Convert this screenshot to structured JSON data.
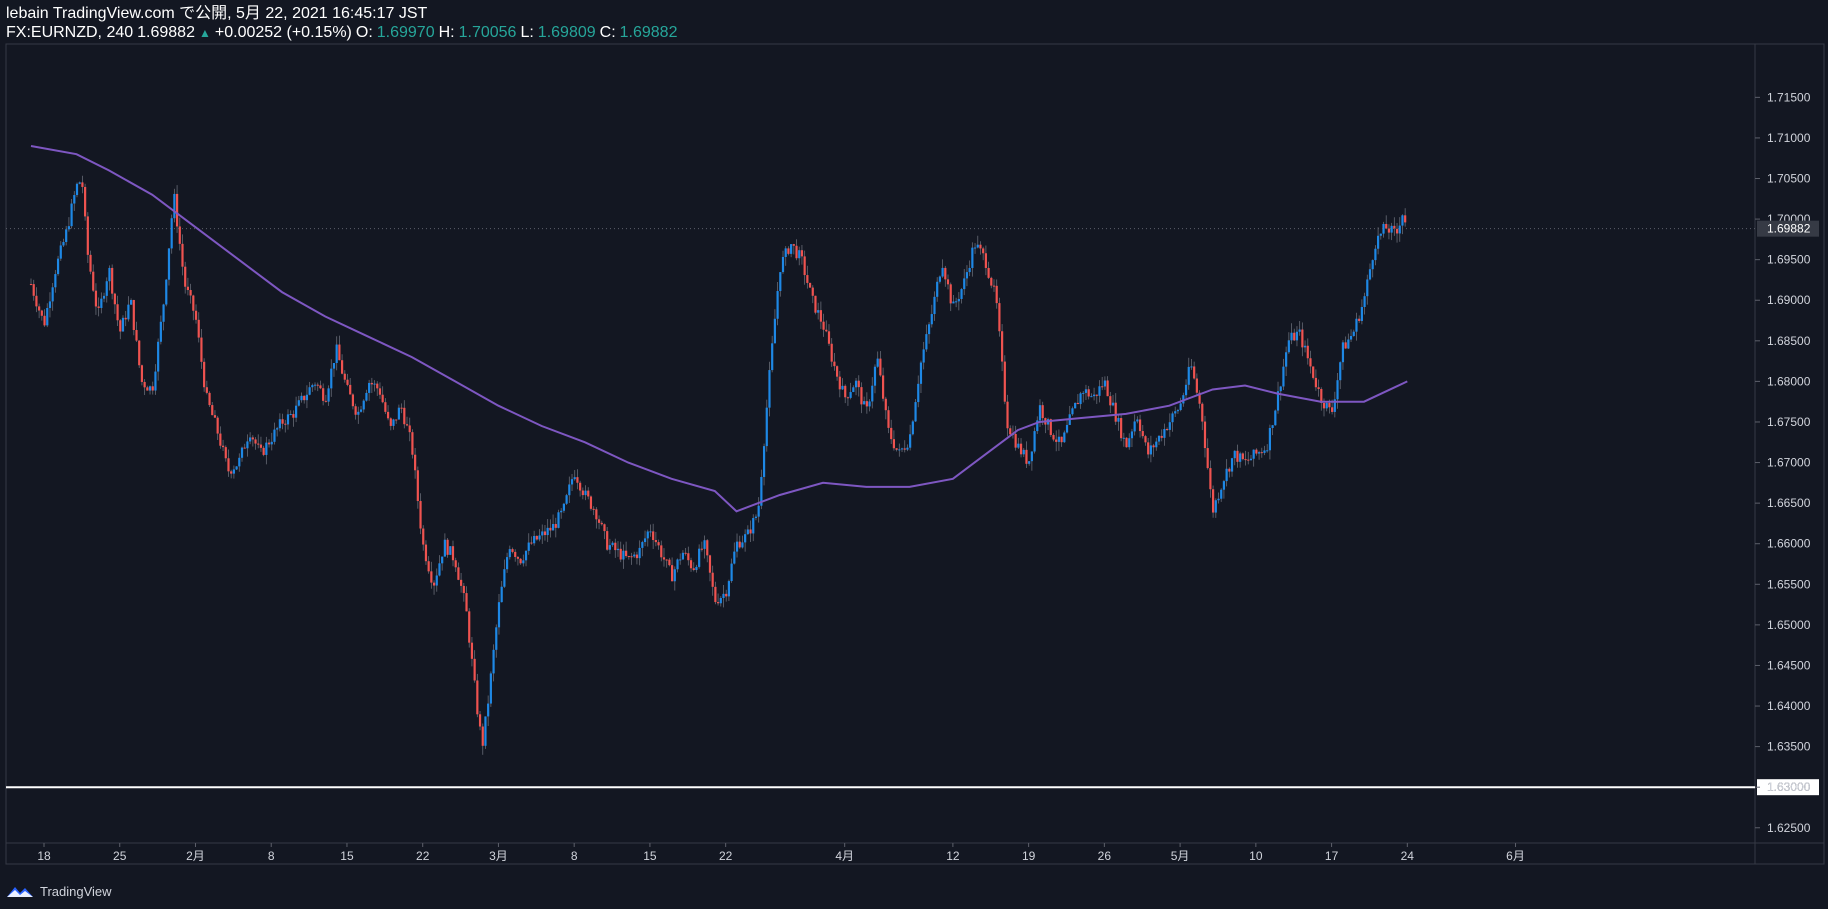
{
  "header": {
    "line1": "lebain TradingView.com で公開, 5月 22, 2021 16:45:17 JST",
    "symbol": "FX:EURNZD, 240",
    "last": "1.69882",
    "change": "+0.00252 (+0.15%)",
    "o_label": "O:",
    "o_val": "1.69970",
    "h_label": "H:",
    "h_val": "1.70056",
    "l_label": "L:",
    "l_val": "1.69809",
    "c_label": "C:",
    "c_val": "1.69882"
  },
  "footer": {
    "brand": "TradingView",
    "logo_icon": "tradingview-logo-icon"
  },
  "colors": {
    "background": "#131722",
    "up": "#2962ff",
    "up_candle": "#1e88e5",
    "down_candle": "#ef5350",
    "ma": "#7e57c2",
    "hline": "#ffffff",
    "axis_text": "#d1d4dc"
  },
  "chart_data": {
    "type": "candlestick",
    "title": "",
    "ylim": [
      1.623,
      1.718
    ],
    "grid": false,
    "y_ticks": [
      "1.71500",
      "1.71000",
      "1.70500",
      "1.70000",
      "1.69500",
      "1.69000",
      "1.68500",
      "1.68000",
      "1.67500",
      "1.67000",
      "1.66500",
      "1.66000",
      "1.65500",
      "1.65000",
      "1.64500",
      "1.64000",
      "1.63500",
      "1.63000",
      "1.62500"
    ],
    "y_tick_values": [
      1.715,
      1.71,
      1.705,
      1.7,
      1.695,
      1.69,
      1.685,
      1.68,
      1.675,
      1.67,
      1.665,
      1.66,
      1.655,
      1.65,
      1.645,
      1.64,
      1.635,
      1.63,
      1.625
    ],
    "x_ticks": [
      "18",
      "25",
      "2月",
      "8",
      "15",
      "22",
      "3月",
      "8",
      "15",
      "22",
      "4月",
      "12",
      "19",
      "26",
      "5月",
      "10",
      "17",
      "24",
      "6月"
    ],
    "x_tick_days": [
      0,
      7,
      14,
      21,
      28,
      35,
      42,
      49,
      56,
      63,
      74,
      84,
      91,
      98,
      105,
      112,
      119,
      126,
      136
    ],
    "last_price_label": "1.69882",
    "last_price": 1.69882,
    "horizontal_line": {
      "value": 1.63,
      "label": "1.63000"
    },
    "price_path": [
      [
        -1.2,
        1.692
      ],
      [
        0,
        1.687
      ],
      [
        1,
        1.6935
      ],
      [
        2,
        1.698
      ],
      [
        3,
        1.704
      ],
      [
        3.5,
        1.705
      ],
      [
        4,
        1.696
      ],
      [
        5,
        1.688
      ],
      [
        6,
        1.694
      ],
      [
        7,
        1.686
      ],
      [
        8,
        1.69
      ],
      [
        9,
        1.68
      ],
      [
        10,
        1.679
      ],
      [
        11,
        1.689
      ],
      [
        12,
        1.703
      ],
      [
        13,
        1.692
      ],
      [
        14,
        1.688
      ],
      [
        15,
        1.678
      ],
      [
        16,
        1.674
      ],
      [
        17,
        1.669
      ],
      [
        18,
        1.67
      ],
      [
        19,
        1.674
      ],
      [
        20,
        1.671
      ],
      [
        21,
        1.673
      ],
      [
        22,
        1.675
      ],
      [
        23,
        1.676
      ],
      [
        24,
        1.678
      ],
      [
        25,
        1.68
      ],
      [
        26,
        1.678
      ],
      [
        27,
        1.684
      ],
      [
        28,
        1.679
      ],
      [
        29,
        1.676
      ],
      [
        30,
        1.68
      ],
      [
        31,
        1.679
      ],
      [
        32,
        1.674
      ],
      [
        33,
        1.677
      ],
      [
        34,
        1.672
      ],
      [
        35,
        1.66
      ],
      [
        36,
        1.655
      ],
      [
        37,
        1.66
      ],
      [
        38,
        1.658
      ],
      [
        39,
        1.652
      ],
      [
        40,
        1.64
      ],
      [
        40.5,
        1.635
      ],
      [
        41,
        1.64
      ],
      [
        42,
        1.652
      ],
      [
        43,
        1.66
      ],
      [
        44,
        1.658
      ],
      [
        45,
        1.66
      ],
      [
        46,
        1.661
      ],
      [
        47,
        1.662
      ],
      [
        48,
        1.664
      ],
      [
        49,
        1.669
      ],
      [
        50,
        1.666
      ],
      [
        51,
        1.664
      ],
      [
        52,
        1.66
      ],
      [
        53,
        1.659
      ],
      [
        54,
        1.658
      ],
      [
        55,
        1.659
      ],
      [
        56,
        1.662
      ],
      [
        57,
        1.659
      ],
      [
        58,
        1.656
      ],
      [
        59,
        1.659
      ],
      [
        60,
        1.657
      ],
      [
        61,
        1.66
      ],
      [
        62,
        1.653
      ],
      [
        63,
        1.654
      ],
      [
        64,
        1.66
      ],
      [
        65,
        1.661
      ],
      [
        66,
        1.664
      ],
      [
        67,
        1.68
      ],
      [
        68,
        1.694
      ],
      [
        69,
        1.697
      ],
      [
        70,
        1.695
      ],
      [
        71,
        1.69
      ],
      [
        72,
        1.687
      ],
      [
        73,
        1.682
      ],
      [
        74,
        1.678
      ],
      [
        75,
        1.68
      ],
      [
        76,
        1.676
      ],
      [
        77,
        1.683
      ],
      [
        78,
        1.674
      ],
      [
        79,
        1.671
      ],
      [
        80,
        1.673
      ],
      [
        81,
        1.682
      ],
      [
        82,
        1.688
      ],
      [
        83,
        1.695
      ],
      [
        84,
        1.689
      ],
      [
        85,
        1.692
      ],
      [
        86,
        1.697
      ],
      [
        87,
        1.695
      ],
      [
        88,
        1.69
      ],
      [
        89,
        1.675
      ],
      [
        90,
        1.672
      ],
      [
        91,
        1.67
      ],
      [
        92,
        1.677
      ],
      [
        93,
        1.674
      ],
      [
        94,
        1.672
      ],
      [
        95,
        1.676
      ],
      [
        96,
        1.679
      ],
      [
        97,
        1.678
      ],
      [
        98,
        1.68
      ],
      [
        99,
        1.676
      ],
      [
        100,
        1.672
      ],
      [
        101,
        1.676
      ],
      [
        102,
        1.671
      ],
      [
        103,
        1.673
      ],
      [
        104,
        1.675
      ],
      [
        105,
        1.677
      ],
      [
        106,
        1.682
      ],
      [
        107,
        1.676
      ],
      [
        108,
        1.664
      ],
      [
        109,
        1.668
      ],
      [
        110,
        1.671
      ],
      [
        111,
        1.67
      ],
      [
        112,
        1.671
      ],
      [
        113,
        1.672
      ],
      [
        114,
        1.678
      ],
      [
        115,
        1.685
      ],
      [
        116,
        1.686
      ],
      [
        117,
        1.682
      ],
      [
        118,
        1.678
      ],
      [
        119,
        1.676
      ],
      [
        120,
        1.684
      ],
      [
        121,
        1.686
      ],
      [
        122,
        1.69
      ],
      [
        123,
        1.697
      ],
      [
        124,
        1.699
      ],
      [
        125,
        1.698
      ],
      [
        125.5,
        1.701
      ],
      [
        126,
        1.699
      ]
    ],
    "ma_path": [
      [
        -1.2,
        1.709
      ],
      [
        3,
        1.708
      ],
      [
        6,
        1.706
      ],
      [
        10,
        1.703
      ],
      [
        14,
        1.699
      ],
      [
        18,
        1.695
      ],
      [
        22,
        1.691
      ],
      [
        26,
        1.688
      ],
      [
        30,
        1.6855
      ],
      [
        34,
        1.683
      ],
      [
        38,
        1.68
      ],
      [
        42,
        1.677
      ],
      [
        46,
        1.6745
      ],
      [
        50,
        1.6725
      ],
      [
        54,
        1.67
      ],
      [
        58,
        1.668
      ],
      [
        62,
        1.6665
      ],
      [
        64,
        1.664
      ],
      [
        68,
        1.666
      ],
      [
        72,
        1.6675
      ],
      [
        76,
        1.667
      ],
      [
        80,
        1.667
      ],
      [
        84,
        1.668
      ],
      [
        86,
        1.67
      ],
      [
        88,
        1.672
      ],
      [
        90,
        1.674
      ],
      [
        92,
        1.675
      ],
      [
        96,
        1.6755
      ],
      [
        100,
        1.676
      ],
      [
        104,
        1.677
      ],
      [
        108,
        1.679
      ],
      [
        111,
        1.6795
      ],
      [
        114,
        1.6785
      ],
      [
        118,
        1.6775
      ],
      [
        122,
        1.6775
      ],
      [
        126,
        1.68
      ]
    ]
  }
}
